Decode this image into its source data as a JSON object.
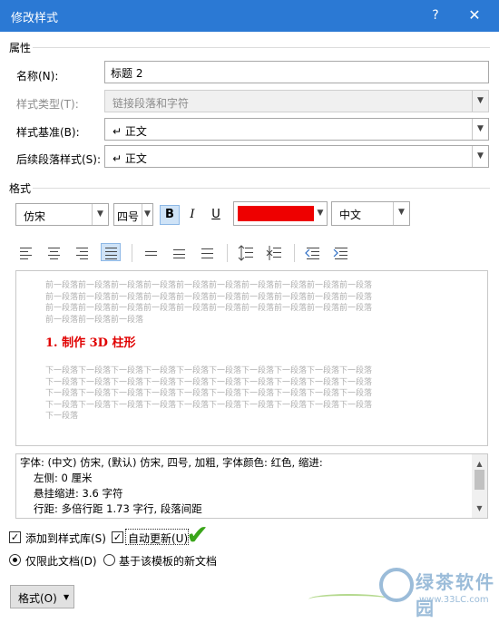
{
  "window": {
    "title": "修改样式",
    "help": "?",
    "close": "✕"
  },
  "properties": {
    "section": "属性",
    "name_label": "名称(N):",
    "name_value": "标题 2",
    "type_label": "样式类型(T):",
    "type_value": "链接段落和字符",
    "based_label": "样式基准(B):",
    "based_value": "↵ 正文",
    "next_label": "后续段落样式(S):",
    "next_value": "↵ 正文"
  },
  "format": {
    "section": "格式",
    "font": "仿宋",
    "size": "四号",
    "bold": "B",
    "italic": "I",
    "underline": "U",
    "font_color": "#ee0000",
    "script": "中文"
  },
  "preview": {
    "prev_text": "前一段落前一段落前一段落前一段落前一段落前一段落前一段落前一段落前一段落前一段落\n前一段落前一段落前一段落前一段落前一段落前一段落前一段落前一段落前一段落前一段落\n前一段落前一段落前一段落前一段落前一段落前一段落前一段落前一段落前一段落前一段落\n前一段落前一段落前一段落",
    "sample": "1. 制作 3D 柱形",
    "next_text": "下一段落下一段落下一段落下一段落下一段落下一段落下一段落下一段落下一段落下一段落\n下一段落下一段落下一段落下一段落下一段落下一段落下一段落下一段落下一段落下一段落\n下一段落下一段落下一段落下一段落下一段落下一段落下一段落下一段落下一段落下一段落\n下一段落下一段落下一段落下一段落下一段落下一段落下一段落下一段落下一段落下一段落\n下一段落"
  },
  "description": {
    "line1": "字体: (中文) 仿宋, (默认) 仿宋, 四号, 加粗, 字体颜色: 红色, 缩进:",
    "line2": "左侧:  0 厘米",
    "line3": "悬挂缩进: 3.6 字符",
    "line4": "行距: 多倍行距 1.73 字行, 段落间距"
  },
  "options": {
    "add_gallery": "添加到样式库(S)",
    "auto_update": "自动更新(U)",
    "only_doc": "仅限此文档(D)",
    "template_docs": "基于该模板的新文档"
  },
  "buttons": {
    "format": "格式(O)"
  },
  "watermark": {
    "line1": "绿茶软件园",
    "line2": "www.33LC.com"
  }
}
